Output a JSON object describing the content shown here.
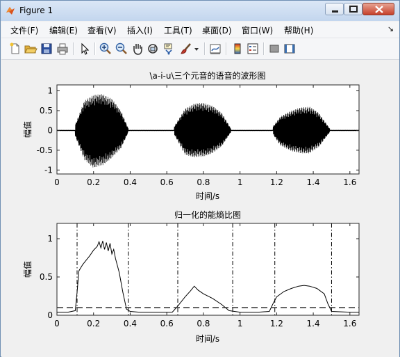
{
  "window": {
    "title": "Figure 1",
    "controls": {
      "minimize": "minimize",
      "maximize": "maximize",
      "close": "close"
    }
  },
  "menu": {
    "items": [
      {
        "label": "文件(F)"
      },
      {
        "label": "编辑(E)"
      },
      {
        "label": "查看(V)"
      },
      {
        "label": "插入(I)"
      },
      {
        "label": "工具(T)"
      },
      {
        "label": "桌面(D)"
      },
      {
        "label": "窗口(W)"
      },
      {
        "label": "帮助(H)"
      }
    ],
    "overflow_icon": "dock-arrow-icon"
  },
  "toolbar": {
    "icons": [
      "new-figure-icon",
      "open-icon",
      "save-icon",
      "print-icon",
      "pointer-icon",
      "zoom-in-icon",
      "zoom-out-icon",
      "pan-hand-icon",
      "rotate-3d-icon",
      "data-cursor-icon",
      "brush-icon",
      "brush-dropdown-icon",
      "link-plot-icon",
      "colorbar-icon",
      "legend-icon",
      "hide-plot-tools-icon",
      "show-plot-tools-icon"
    ]
  },
  "chart_data": [
    {
      "type": "line",
      "title": "\\a-i-u\\三个元音的语音的波形图",
      "xlabel": "时间/s",
      "ylabel": "幅值",
      "xlim": [
        0,
        1.65
      ],
      "ylim": [
        -1.1,
        1.15
      ],
      "xticks": [
        "0",
        "0.2",
        "0.4",
        "0.6",
        "0.8",
        "1",
        "1.2",
        "1.4",
        "1.6"
      ],
      "yticks": [
        "-1",
        "-0.5",
        "0",
        "0.5",
        "1"
      ],
      "grid": false,
      "series": [
        {
          "description": "speech waveform, three voiced segments",
          "segments": [
            {
              "x": [
                0.1,
                0.15,
                0.2,
                0.25,
                0.3,
                0.35,
                0.39
              ],
              "upper": [
                0.15,
                0.75,
                0.9,
                0.92,
                0.8,
                0.5,
                0.05
              ],
              "lower": [
                -0.15,
                -0.75,
                -0.95,
                -0.88,
                -0.7,
                -0.45,
                -0.05
              ]
            },
            {
              "x": [
                0.64,
                0.7,
                0.75,
                0.8,
                0.85,
                0.9,
                0.95
              ],
              "upper": [
                0.1,
                0.55,
                0.68,
                0.7,
                0.62,
                0.45,
                0.05
              ],
              "lower": [
                -0.1,
                -0.62,
                -0.68,
                -0.66,
                -0.58,
                -0.4,
                -0.05
              ]
            },
            {
              "x": [
                1.18,
                1.22,
                1.28,
                1.33,
                1.38,
                1.43,
                1.49
              ],
              "upper": [
                0.1,
                0.35,
                0.5,
                0.58,
                0.6,
                0.45,
                0.05
              ],
              "lower": [
                -0.1,
                -0.38,
                -0.52,
                -0.58,
                -0.58,
                -0.42,
                -0.05
              ]
            }
          ]
        }
      ]
    },
    {
      "type": "line",
      "title": "归一化的能熵比图",
      "xlabel": "时间/s",
      "ylabel": "幅值",
      "xlim": [
        0,
        1.65
      ],
      "ylim": [
        0,
        1.2
      ],
      "xticks": [
        "0",
        "0.2",
        "0.4",
        "0.6",
        "0.8",
        "1",
        "1.2",
        "1.4",
        "1.6"
      ],
      "yticks": [
        "0",
        "0.5",
        "1"
      ],
      "grid": false,
      "series": [
        {
          "style": "solid",
          "x": [
            0.0,
            0.06,
            0.1,
            0.11,
            0.12,
            0.14,
            0.16,
            0.18,
            0.2,
            0.22,
            0.23,
            0.24,
            0.25,
            0.26,
            0.27,
            0.28,
            0.29,
            0.3,
            0.31,
            0.32,
            0.34,
            0.36,
            0.38,
            0.4,
            0.45,
            0.55,
            0.63,
            0.66,
            0.7,
            0.73,
            0.75,
            0.77,
            0.8,
            0.85,
            0.9,
            0.94,
            1.0,
            1.1,
            1.16,
            1.18,
            1.2,
            1.24,
            1.28,
            1.32,
            1.35,
            1.38,
            1.42,
            1.46,
            1.48,
            1.5,
            1.6,
            1.65
          ],
          "y": [
            0.04,
            0.04,
            0.06,
            0.3,
            0.58,
            0.66,
            0.72,
            0.78,
            0.85,
            0.9,
            0.96,
            0.88,
            0.97,
            0.86,
            0.95,
            0.84,
            0.94,
            0.8,
            0.86,
            0.74,
            0.56,
            0.3,
            0.08,
            0.05,
            0.04,
            0.04,
            0.04,
            0.12,
            0.24,
            0.32,
            0.38,
            0.33,
            0.28,
            0.22,
            0.14,
            0.06,
            0.04,
            0.04,
            0.05,
            0.15,
            0.24,
            0.31,
            0.35,
            0.38,
            0.39,
            0.38,
            0.35,
            0.28,
            0.15,
            0.05,
            0.04,
            0.04
          ]
        },
        {
          "style": "dashed",
          "x": [
            0.0,
            1.65
          ],
          "y": [
            0.1,
            0.1
          ]
        }
      ],
      "vlines": [
        0.11,
        0.39,
        0.66,
        0.96,
        1.19,
        1.5
      ]
    }
  ]
}
